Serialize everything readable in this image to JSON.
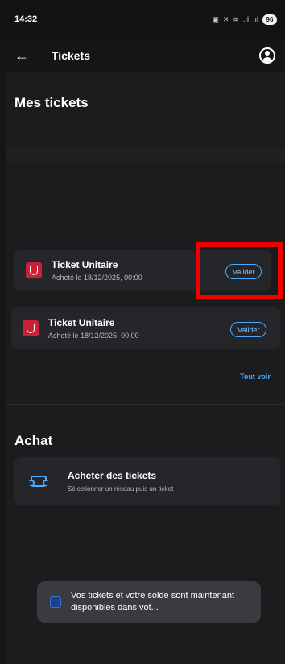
{
  "status_bar": {
    "time": "14:32",
    "icons": [
      "#",
      "▣",
      "✕",
      "≋",
      ".ıl",
      ".ıl"
    ],
    "battery": "96"
  },
  "app_bar": {
    "back_icon": "arrow-left-icon",
    "title": "Tickets",
    "account_icon": "account-circle-icon"
  },
  "mes_tickets": {
    "title": "Mes tickets",
    "tickets": [
      {
        "name": "Ticket Unitaire",
        "date": "Acheté le 18/12/2025, 00:00",
        "action": "Valider"
      },
      {
        "name": "Ticket Unitaire",
        "date": "Acheté le 18/12/2025, 00:00",
        "action": "Valider"
      }
    ],
    "see_all": "Tout voir"
  },
  "achat": {
    "title": "Achat",
    "item_title": "Acheter des tickets",
    "item_subtitle": "Sélectionner un réseau puis un ticket"
  },
  "toast": {
    "message": "Vos tickets et votre solde sont maintenant disponibles dans vot..."
  },
  "colors": {
    "background": "#151618",
    "card": "#25262a",
    "accent": "#4aa8ff",
    "ticket_logo": "#c7223a",
    "highlight": "#f20000"
  }
}
